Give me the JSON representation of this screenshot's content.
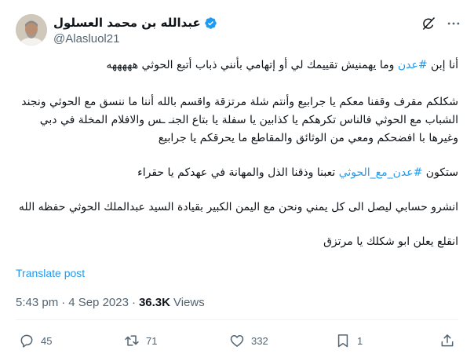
{
  "author": {
    "display_name": "عبدالله بن محمد العسلول",
    "handle": "@Alasluol21",
    "verified": true
  },
  "post": {
    "paragraphs": [
      {
        "segments": [
          {
            "text": "أنا إبن ",
            "hashtag": false
          },
          {
            "text": "#عدن",
            "hashtag": true
          },
          {
            "text": " وما يهمنيش تقييمك لي أو إتهامي بأنني ذباب أتبع الحوثي هههههه",
            "hashtag": false
          }
        ]
      },
      {
        "segments": [
          {
            "text": "شكلكم مقرف وقفنا معكم يا جرابيع وأنتم شلة مرتزقة واقسم بالله أننا ما ننسق مع الحوثي ونجند الشباب مع الحوثي  فالناس تكرهكم يا كذابين يا سفلة يا بتاع الجنـ ـس والافلام المخلة في دبي وغيرها با افضحكم ومعي من الوثائق والمقاطع ما يحرقكم يا جرابيع",
            "hashtag": false
          }
        ]
      },
      {
        "segments": [
          {
            "text": "ستكون ",
            "hashtag": false
          },
          {
            "text": "#عدن_مع_الحوثي",
            "hashtag": true
          },
          {
            "text": " تعبنا وذقنا الذل والمهانة في عهدكم يا حقراء",
            "hashtag": false
          }
        ]
      },
      {
        "segments": [
          {
            "text": "انشرو حسابي ليصل الى كل يمني ونحن مع اليمن الكبير بقيادة السيد عبدالملك الحوثي حفظه الله",
            "hashtag": false
          }
        ]
      },
      {
        "segments": [
          {
            "text": "انقلع يعلن ابو شكلك يا مرتزق",
            "hashtag": false
          }
        ]
      }
    ],
    "translate_label": "Translate post",
    "time": "5:43 pm",
    "separator": "·",
    "date": "4 Sep 2023",
    "views_count": "36.3K",
    "views_label": "Views"
  },
  "actions": {
    "replies": "45",
    "reposts": "71",
    "likes": "332",
    "bookmarks": "1"
  },
  "colors": {
    "accent": "#1d9bf0",
    "text": "#0f1419",
    "secondary": "#536471",
    "divider": "#eff3f4"
  },
  "icons": [
    "verified-badge-icon",
    "grok-icon",
    "more-icon",
    "reply-icon",
    "repost-icon",
    "like-icon",
    "bookmark-icon",
    "share-icon"
  ]
}
